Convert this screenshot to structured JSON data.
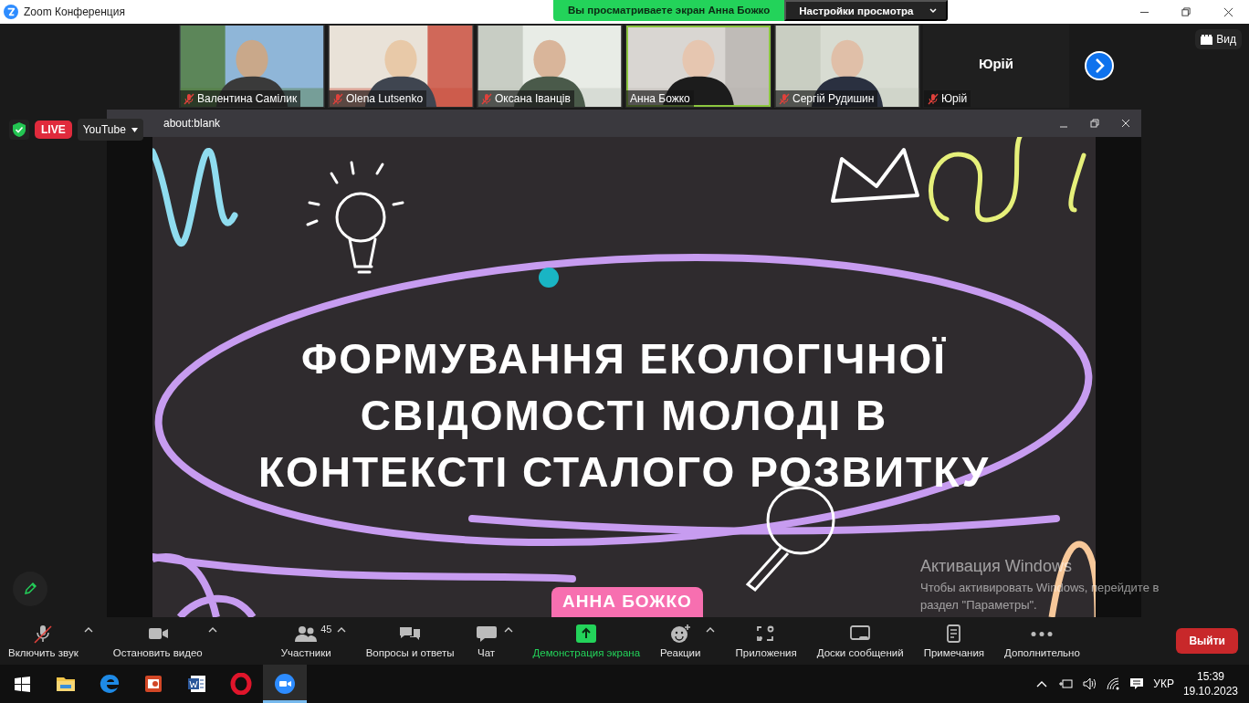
{
  "window": {
    "title": "Zoom Конференция"
  },
  "share_banner": {
    "text": "Вы просматриваете экран Анна Божко",
    "settings_label": "Настройки просмотра"
  },
  "participants": [
    {
      "name": "Валентина Самілик",
      "kind": "video",
      "muted": true,
      "active_speaker": false
    },
    {
      "name": "Olena Lutsenko",
      "kind": "video",
      "muted": true,
      "active_speaker": false
    },
    {
      "name": "Оксана Іванців",
      "kind": "video",
      "muted": true,
      "active_speaker": false
    },
    {
      "name": "Анна Божко",
      "kind": "video",
      "muted": false,
      "active_speaker": true
    },
    {
      "name": "Сергій Рудишин",
      "kind": "video",
      "muted": true,
      "active_speaker": false
    },
    {
      "name": "Юрій",
      "kind": "no_video",
      "display_name": "Юрій",
      "muted": true,
      "active_speaker": false
    }
  ],
  "view_button": "Вид",
  "live": {
    "badge": "LIVE",
    "platform": "YouTube"
  },
  "shared_window": {
    "title": "about:blank"
  },
  "slide": {
    "title_lines": [
      "ФОРМУВАННЯ ЕКОЛОГІЧНОЇ",
      "СВІДОМОСТІ МОЛОДІ В",
      "КОНТЕКСТІ СТАЛОГО РОЗВИТКУ"
    ],
    "presenter": "АННА БОЖКО"
  },
  "activation": {
    "title": "Активация Windows",
    "text": "Чтобы активировать Windows, перейдите в раздел \"Параметры\"."
  },
  "toolbar": [
    {
      "kind": "mic",
      "label": "Включить звук",
      "menu": true,
      "muted": true,
      "active": false
    },
    {
      "kind": "video",
      "label": "Остановить видео",
      "menu": true,
      "active": false
    },
    {
      "kind": "participants",
      "label": "Участники",
      "count": "45",
      "menu": true,
      "active": false
    },
    {
      "kind": "qa",
      "label": "Вопросы и ответы",
      "menu": false,
      "active": false
    },
    {
      "kind": "chat",
      "label": "Чат",
      "menu": true,
      "active": false
    },
    {
      "kind": "share",
      "label": "Демонстрация экрана",
      "menu": false,
      "active": true
    },
    {
      "kind": "reactions",
      "label": "Реакции",
      "menu": true,
      "active": false
    },
    {
      "kind": "apps",
      "label": "Приложения",
      "menu": false,
      "active": false
    },
    {
      "kind": "whiteboard",
      "label": "Доски сообщений",
      "menu": false,
      "active": false
    },
    {
      "kind": "notes",
      "label": "Примечания",
      "menu": false,
      "active": false
    },
    {
      "kind": "more",
      "label": "Дополнительно",
      "menu": false,
      "active": false
    }
  ],
  "leave_button": "Выйти",
  "taskbar": {
    "apps": [
      {
        "kind": "folder",
        "selected": false
      },
      {
        "kind": "edge",
        "selected": false
      },
      {
        "kind": "slides",
        "selected": false
      },
      {
        "kind": "word",
        "selected": false
      },
      {
        "kind": "opera",
        "selected": false
      },
      {
        "kind": "zoom",
        "selected": true
      }
    ],
    "language": "УКР",
    "time": "15:39",
    "date": "19.10.2023"
  }
}
